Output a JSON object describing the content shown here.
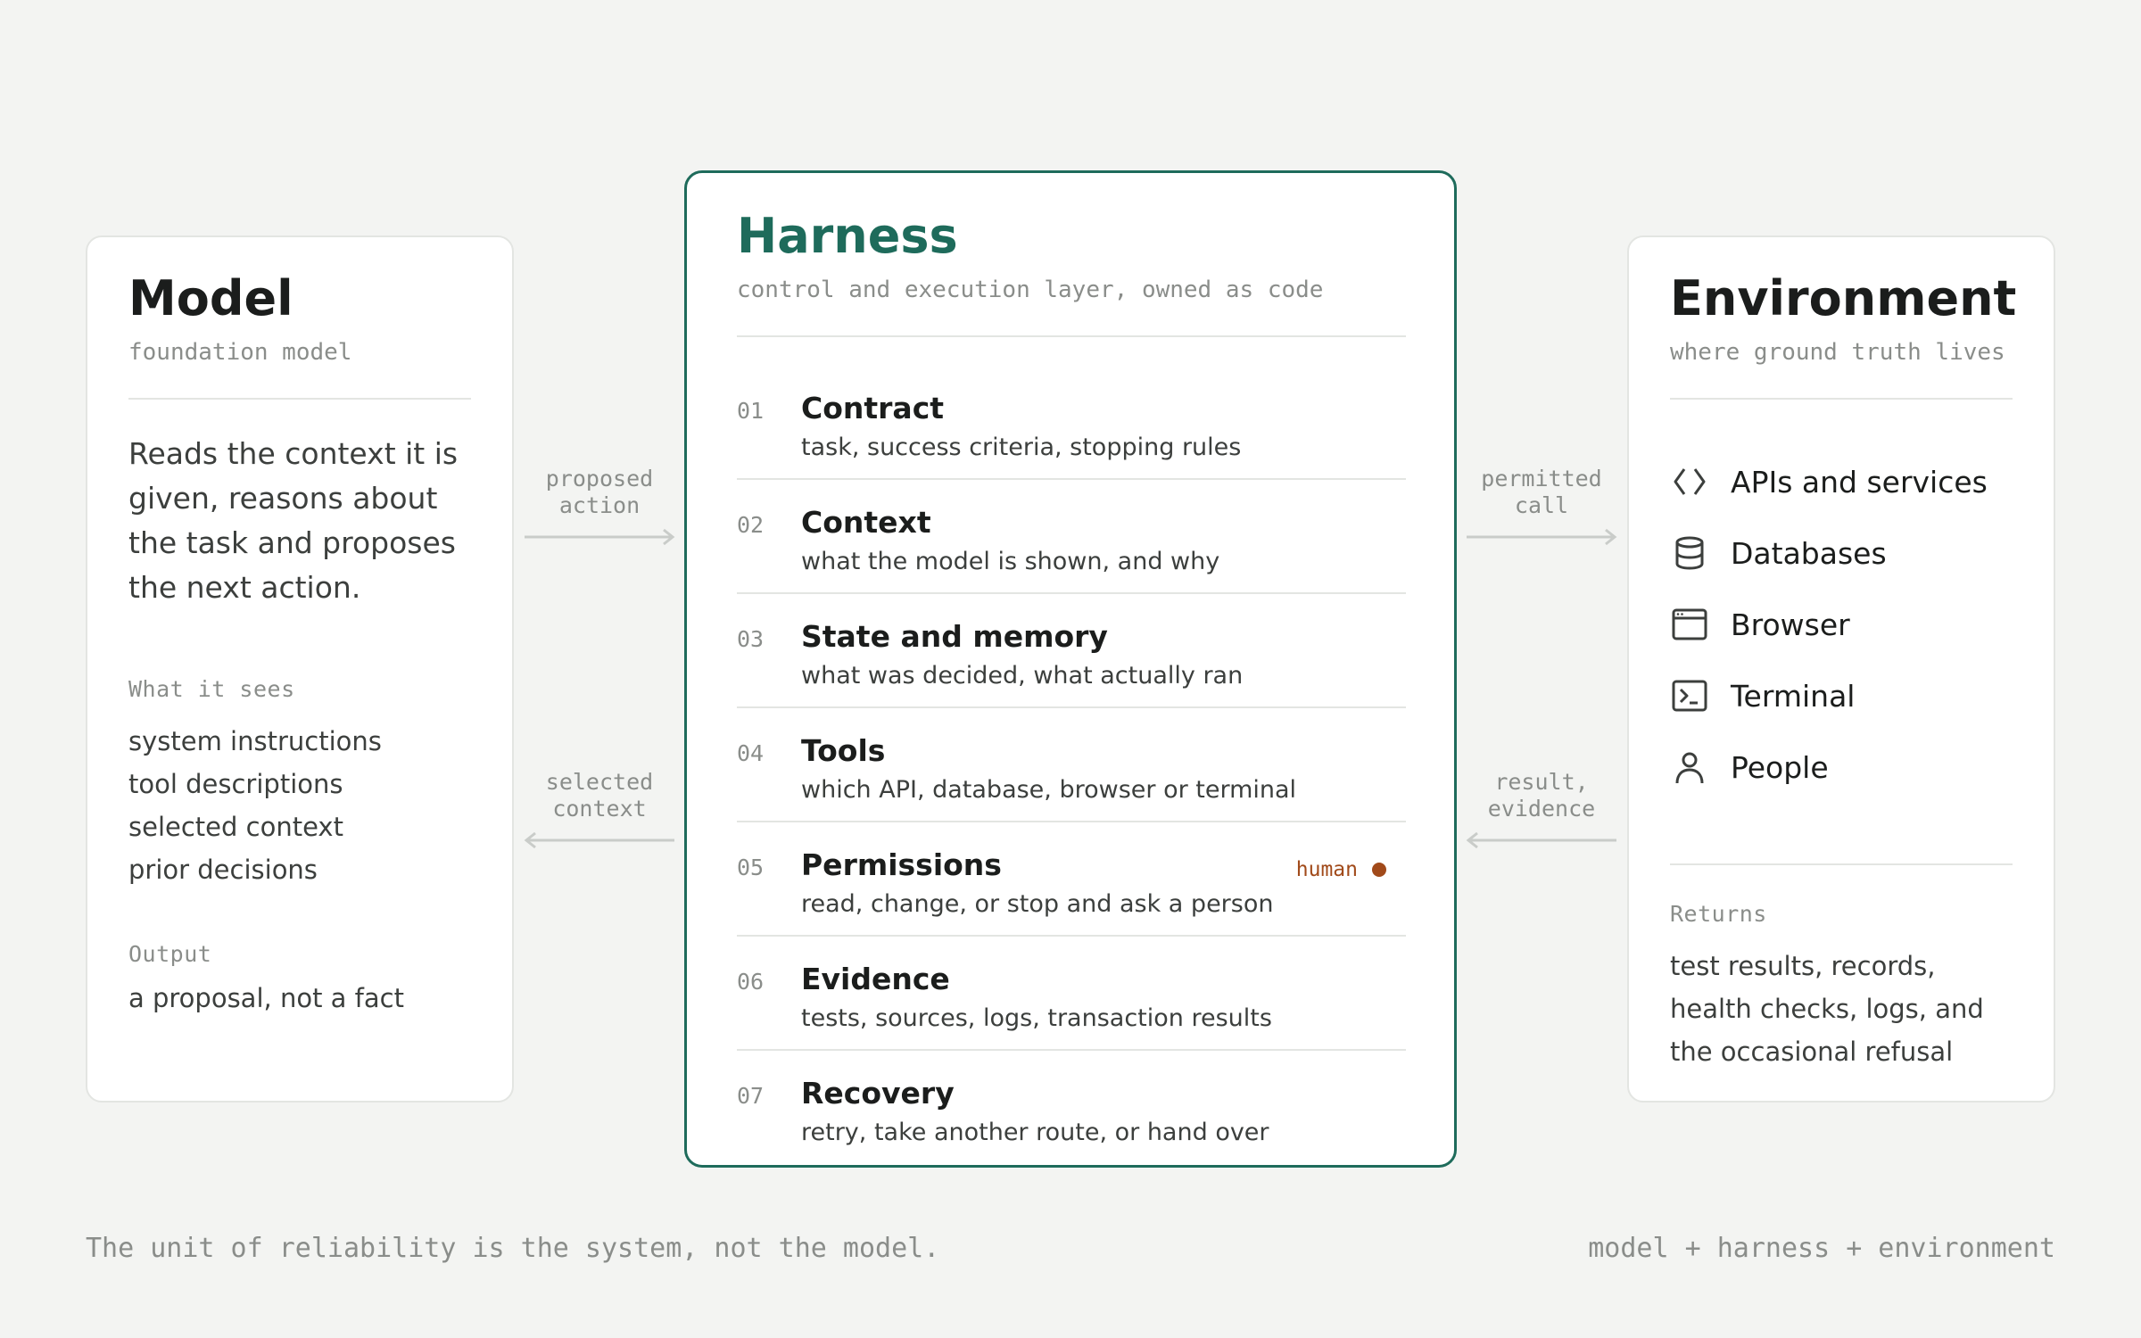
{
  "model": {
    "title": "Model",
    "subtitle": "foundation model",
    "description": "Reads the context it is given, reasons about the task and proposes the next action.",
    "sees_label": "What it sees",
    "sees_items": [
      "system instructions",
      "tool descriptions",
      "selected context",
      "prior decisions"
    ],
    "output_label": "Output",
    "output_text": "a proposal, not a fact"
  },
  "harness": {
    "title": "Harness",
    "subtitle": "control and execution layer, owned as code",
    "steps": [
      {
        "num": "01",
        "title": "Contract",
        "desc": "task, success criteria, stopping rules"
      },
      {
        "num": "02",
        "title": "Context",
        "desc": "what the model is shown, and why"
      },
      {
        "num": "03",
        "title": "State and memory",
        "desc": "what was decided, what actually ran"
      },
      {
        "num": "04",
        "title": "Tools",
        "desc": "which API, database, browser or terminal"
      },
      {
        "num": "05",
        "title": "Permissions",
        "desc": "read, change, or stop and ask a person",
        "badge": "human"
      },
      {
        "num": "06",
        "title": "Evidence",
        "desc": "tests, sources, logs, transaction results"
      },
      {
        "num": "07",
        "title": "Recovery",
        "desc": "retry, take another route, or hand over"
      }
    ]
  },
  "environment": {
    "title": "Environment",
    "subtitle": "where ground truth lives",
    "items": [
      {
        "label": "APIs and services",
        "icon": "code-brackets-icon"
      },
      {
        "label": "Databases",
        "icon": "database-icon"
      },
      {
        "label": "Browser",
        "icon": "browser-window-icon"
      },
      {
        "label": "Terminal",
        "icon": "terminal-icon"
      },
      {
        "label": "People",
        "icon": "person-icon"
      }
    ],
    "returns_label": "Returns",
    "returns_text": "test results, records, health checks, logs, and the occasional refusal"
  },
  "flows": {
    "proposed": [
      "proposed",
      "action"
    ],
    "selected": [
      "selected",
      "context"
    ],
    "permitted": [
      "permitted",
      "call"
    ],
    "result": [
      "result,",
      "evidence"
    ]
  },
  "footer": {
    "left": "The unit of reliability is the system, not the model.",
    "right": "model + harness + environment"
  },
  "colors": {
    "accent": "#1e6b5b",
    "human": "#a14a1a",
    "muted": "#8a8d8a",
    "background": "#f3f4f2"
  }
}
